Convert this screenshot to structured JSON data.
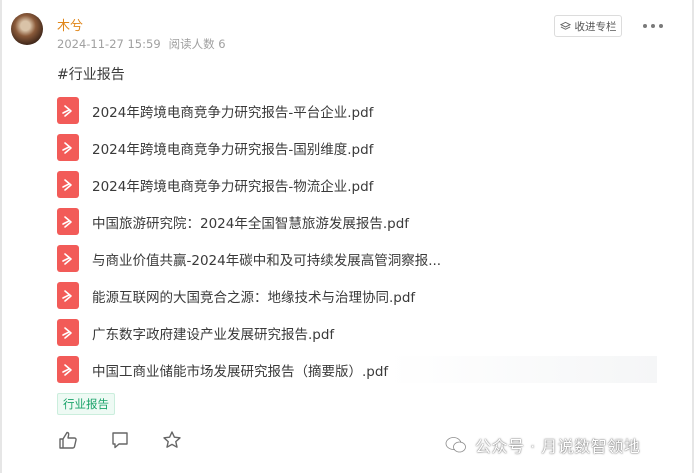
{
  "post": {
    "author": "木兮",
    "date": "2024-11-27 15:59",
    "read_count": "阅读人数 6",
    "collect_label": "收进专栏",
    "hashtag": "#行业报告"
  },
  "files": [
    {
      "name": "2024年跨境电商竞争力研究报告-平台企业.pdf"
    },
    {
      "name": "2024年跨境电商竞争力研究报告-国别维度.pdf"
    },
    {
      "name": "2024年跨境电商竞争力研究报告-物流企业.pdf"
    },
    {
      "name": "中国旅游研究院：2024年全国智慧旅游发展报告.pdf"
    },
    {
      "name": "与商业价值共赢-2024年碳中和及可持续发展高管洞察报..."
    },
    {
      "name": "能源互联网的大国竞合之源：地缘技术与治理协同.pdf"
    },
    {
      "name": "广东数字政府建设产业发展研究报告.pdf"
    },
    {
      "name": "中国工商业储能市场发展研究报告（摘要版）.pdf"
    }
  ],
  "tag": "行业报告",
  "watermark": "公众号 · 月说数智领地",
  "colors": {
    "author": "#e0861a",
    "pdf_icon": "#f25b58",
    "tag_text": "#1aa36a",
    "tag_bg": "#eefaf4"
  },
  "icons": [
    "avatar",
    "collect-icon",
    "more-icon",
    "pdf-icon",
    "like-icon",
    "comment-icon",
    "star-icon",
    "wechat-icon"
  ]
}
